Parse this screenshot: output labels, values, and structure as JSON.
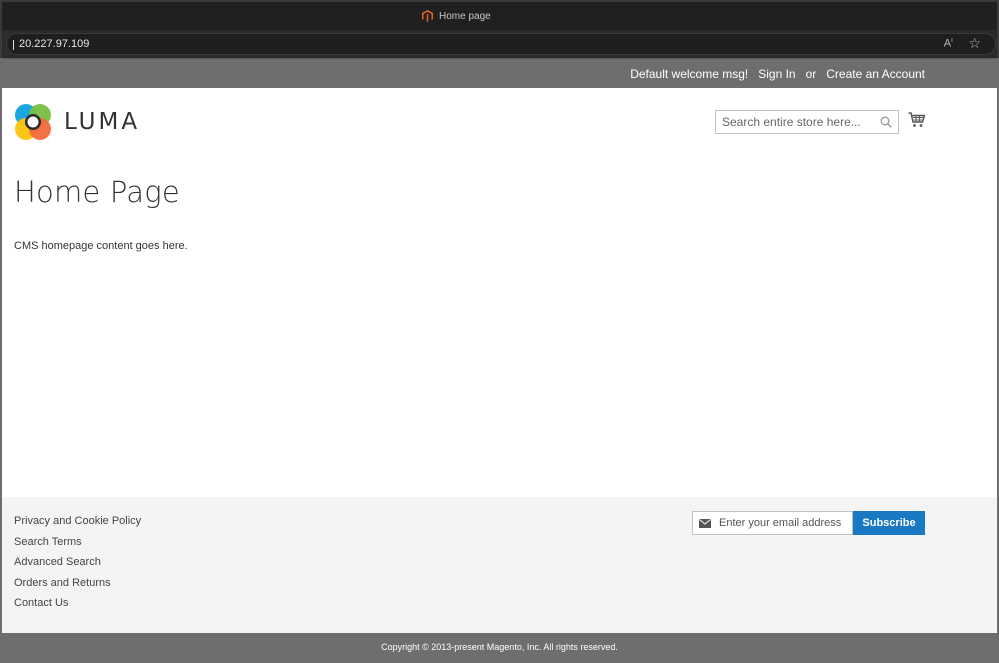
{
  "browser": {
    "tab_title": "Home page",
    "url": "20.227.97.109"
  },
  "panel": {
    "welcome": "Default welcome msg!",
    "sign_in": "Sign In",
    "or": "or",
    "create_account": "Create an Account"
  },
  "header": {
    "logo_text": "LUMA",
    "search_placeholder": "Search entire store here..."
  },
  "main": {
    "title": "Home Page",
    "content": "CMS homepage content goes here."
  },
  "footer": {
    "links": [
      "Privacy and Cookie Policy",
      "Search Terms",
      "Advanced Search",
      "Orders and Returns",
      "Contact Us"
    ],
    "newsletter_placeholder": "Enter your email address",
    "subscribe_label": "Subscribe"
  },
  "copyright": "Copyright © 2013-present Magento, Inc. All rights reserved.",
  "colors": {
    "accent": "#1979c3",
    "panel_bg": "#6e6e6e",
    "footer_bg": "#f4f4f4"
  }
}
